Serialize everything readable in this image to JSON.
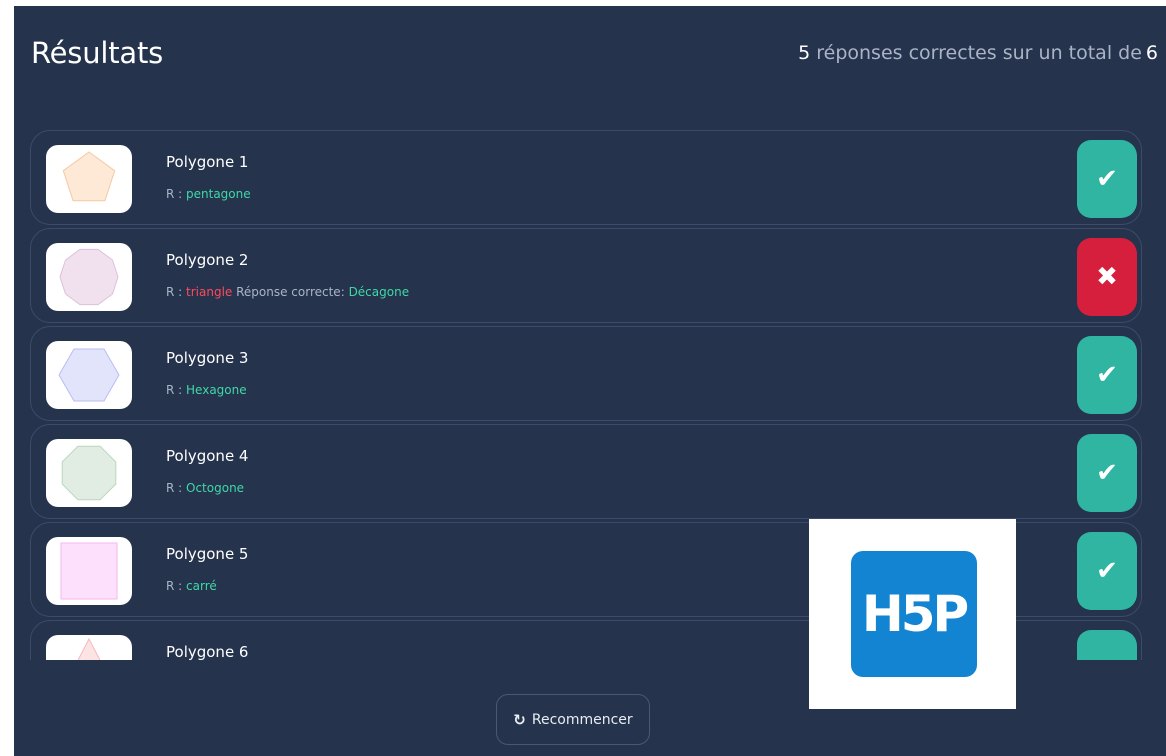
{
  "header": {
    "title": "Résultats",
    "score_correct": "5",
    "score_text": "réponses correctes sur un total de",
    "score_total": "6"
  },
  "items": [
    {
      "title": "Polygone 1",
      "r_label": "R :",
      "answer": "pentagone",
      "answer_status": "correct",
      "correct_label": "",
      "correct_answer": "",
      "result": "correct",
      "shape": "pentagon",
      "fill": "#fde9d6",
      "stroke": "#f3c9a4"
    },
    {
      "title": "Polygone 2",
      "r_label": "R :",
      "answer": "triangle",
      "answer_status": "wrong",
      "correct_label": "Réponse correcte:",
      "correct_answer": "Décagone",
      "result": "wrong",
      "shape": "decagon",
      "fill": "#f1e1ef",
      "stroke": "#dcc0da"
    },
    {
      "title": "Polygone 3",
      "r_label": "R :",
      "answer": "Hexagone",
      "answer_status": "correct",
      "correct_label": "",
      "correct_answer": "",
      "result": "correct",
      "shape": "hexagon",
      "fill": "#e2e4fb",
      "stroke": "#b9bdf0"
    },
    {
      "title": "Polygone 4",
      "r_label": "R :",
      "answer": "Octogone",
      "answer_status": "correct",
      "correct_label": "",
      "correct_answer": "",
      "result": "correct",
      "shape": "octagon",
      "fill": "#e1ede2",
      "stroke": "#bad6bd"
    },
    {
      "title": "Polygone 5",
      "r_label": "R :",
      "answer": "carré",
      "answer_status": "correct",
      "correct_label": "",
      "correct_answer": "",
      "result": "correct",
      "shape": "square",
      "fill": "#fde0fb",
      "stroke": "#f2b9ee"
    },
    {
      "title": "Polygone 6",
      "r_label": "",
      "answer": "",
      "answer_status": "correct",
      "correct_label": "",
      "correct_answer": "",
      "result": "correct",
      "shape": "triangle",
      "fill": "#fde4e4",
      "stroke": "#f3baba"
    }
  ],
  "icons": {
    "correct": "checkmark-icon",
    "wrong": "close-icon",
    "restart": "refresh-icon"
  },
  "restart_button": {
    "label": "Recommencer"
  },
  "logo": {
    "text": "H5P"
  },
  "colors": {
    "background": "#25334d",
    "correct_badge": "#2fb5a2",
    "wrong_badge": "#d61f3c",
    "correct_text": "#3fd8a8",
    "wrong_text": "#ff4a5a"
  }
}
